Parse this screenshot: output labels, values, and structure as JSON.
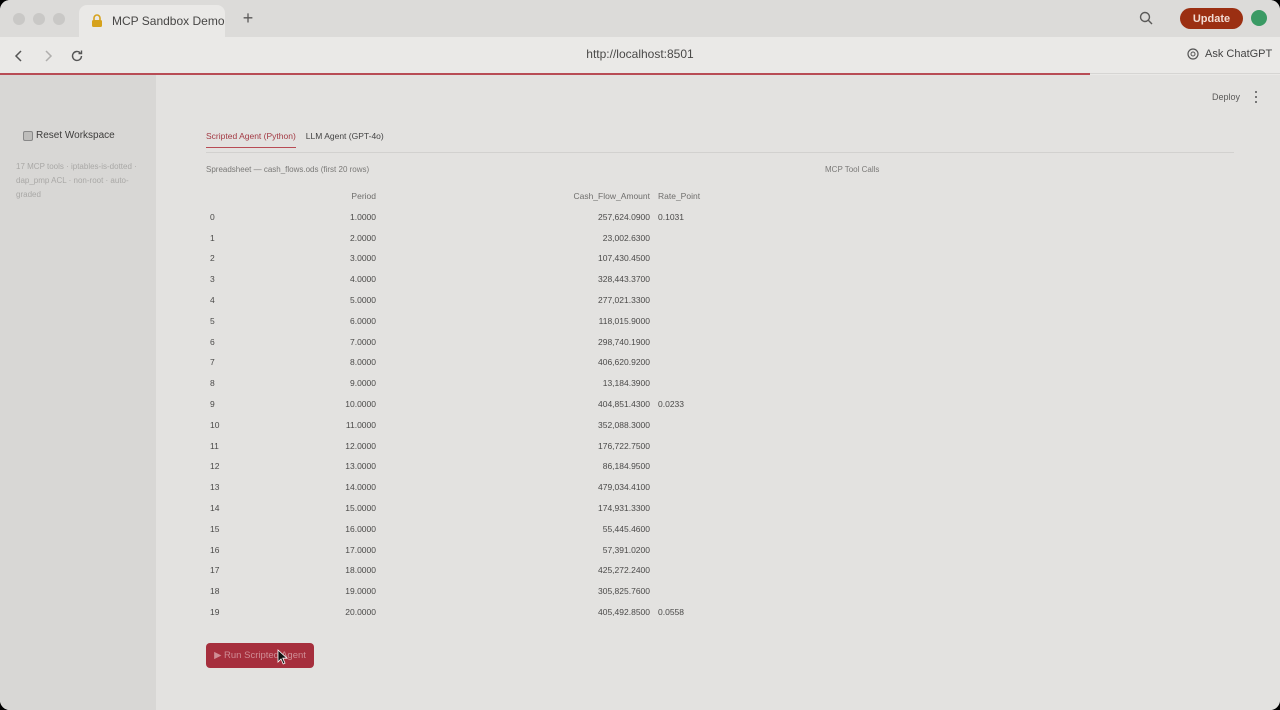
{
  "browser": {
    "tab_title": "MCP Sandbox Demo",
    "new_tab_label": "+",
    "update_label": "Update",
    "url": "http://localhost:8501",
    "ask_label": "Ask ChatGPT"
  },
  "app": {
    "deploy_label": "Deploy",
    "sidebar": {
      "reset_label": "Reset Workspace",
      "note": "17 MCP tools · iptables-is-dotted · dap_pmp ACL · non-root · auto-graded"
    },
    "tabs": [
      {
        "label": "Scripted Agent (Python)",
        "active": true
      },
      {
        "label": "LLM Agent (GPT-4o)",
        "active": false
      }
    ],
    "spreadsheet_caption": "Spreadsheet — cash_flows.ods (first 20 rows)",
    "tool_calls_caption": "MCP Tool Calls",
    "table": {
      "headers": [
        "",
        "Period",
        "Cash_Flow_Amount",
        "Rate_Point"
      ],
      "rows": [
        [
          "0",
          "1.0000",
          "257,624.0900",
          "0.1031"
        ],
        [
          "1",
          "2.0000",
          "23,002.6300",
          ""
        ],
        [
          "2",
          "3.0000",
          "107,430.4500",
          ""
        ],
        [
          "3",
          "4.0000",
          "328,443.3700",
          ""
        ],
        [
          "4",
          "5.0000",
          "277,021.3300",
          ""
        ],
        [
          "5",
          "6.0000",
          "118,015.9000",
          ""
        ],
        [
          "6",
          "7.0000",
          "298,740.1900",
          ""
        ],
        [
          "7",
          "8.0000",
          "406,620.9200",
          ""
        ],
        [
          "8",
          "9.0000",
          "13,184.3900",
          ""
        ],
        [
          "9",
          "10.0000",
          "404,851.4300",
          "0.0233"
        ],
        [
          "10",
          "11.0000",
          "352,088.3000",
          ""
        ],
        [
          "11",
          "12.0000",
          "176,722.7500",
          ""
        ],
        [
          "12",
          "13.0000",
          "86,184.9500",
          ""
        ],
        [
          "13",
          "14.0000",
          "479,034.4100",
          ""
        ],
        [
          "14",
          "15.0000",
          "174,931.3300",
          ""
        ],
        [
          "15",
          "16.0000",
          "55,445.4600",
          ""
        ],
        [
          "16",
          "17.0000",
          "57,391.0200",
          ""
        ],
        [
          "17",
          "18.0000",
          "425,272.2400",
          ""
        ],
        [
          "18",
          "19.0000",
          "305,825.7600",
          ""
        ],
        [
          "19",
          "20.0000",
          "405,492.8500",
          "0.0558"
        ]
      ]
    },
    "run_button_label": "▶ Run Scripted Agent"
  }
}
